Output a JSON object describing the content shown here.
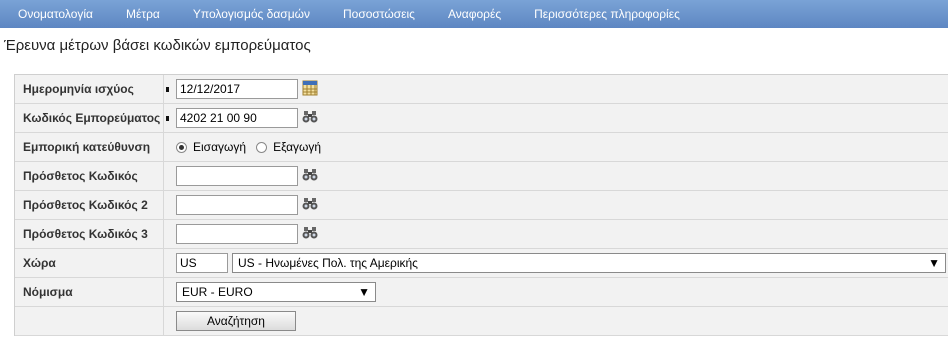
{
  "nav": {
    "items": [
      "Ονοματολογία",
      "Μέτρα",
      "Υπολογισμός δασμών",
      "Ποσοστώσεις",
      "Αναφορές",
      "Περισσότερες πληροφορίες"
    ]
  },
  "page_title": "Έρευνα μέτρων βάσει κωδικών εμπορεύματος",
  "form": {
    "date_label": "Ημερομηνία ισχύος",
    "date_value": "12/12/2017",
    "code_label": "Κωδικός Εμπορεύματος",
    "code_value": "4202 21 00 90",
    "direction_label": "Εμπορική κατεύθυνση",
    "import_label": "Εισαγωγή",
    "export_label": "Εξαγωγή",
    "additional1_label": "Πρόσθετος Κωδικός",
    "additional2_label": "Πρόσθετος Κωδικός 2",
    "additional3_label": "Πρόσθετος Κωδικός 3",
    "country_label": "Χώρα",
    "country_code": "US",
    "country_selected": "US - Ηνωμένες Πολ. της Αμερικής",
    "currency_label": "Νόμισμα",
    "currency_selected": "EUR - EURO",
    "search_label": "Αναζήτηση"
  },
  "icons": {
    "calendar": "calendar-icon",
    "lookup": "binoculars-icon",
    "dropdown": "caret-down-icon"
  }
}
